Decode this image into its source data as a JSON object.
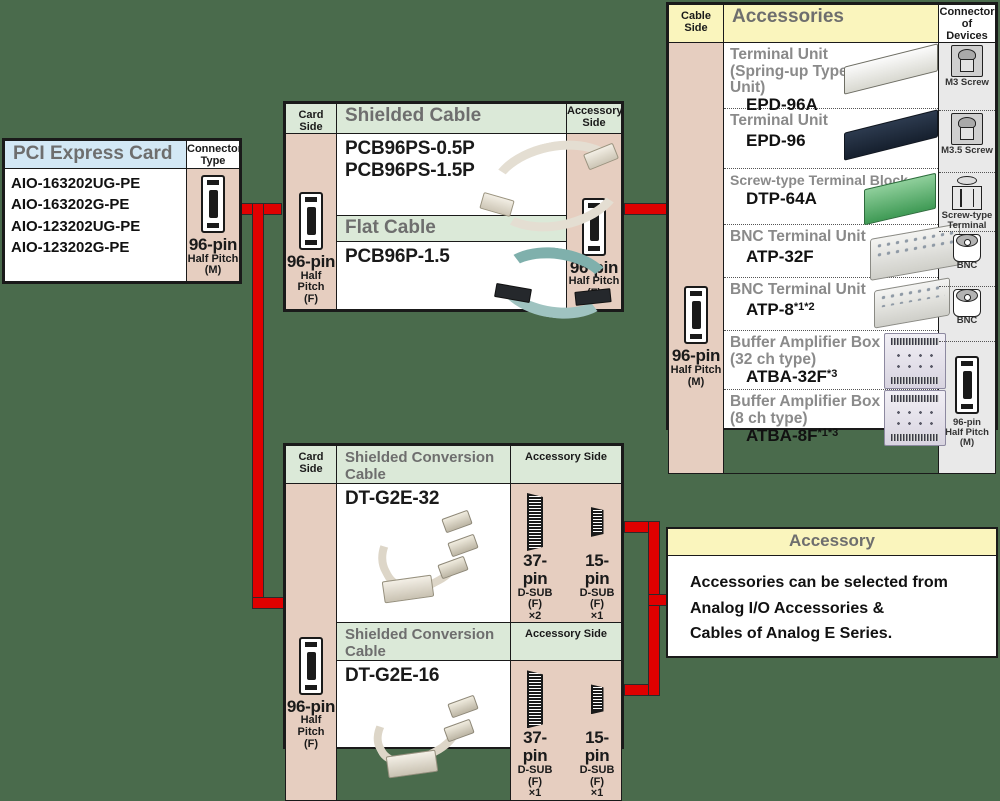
{
  "card_table": {
    "header": {
      "title": "PCI Express Card",
      "connector_col": "Connector\nType"
    },
    "models": [
      "AIO-163202UG-PE",
      "AIO-163202G-PE",
      "AIO-123202UG-PE",
      "AIO-123202G-PE"
    ],
    "connector": {
      "icon": "half-pitch-connector-icon",
      "pins": "96-pin",
      "type": "Half Pitch",
      "gender": "(M)"
    },
    "header_color": "#d3e8f5",
    "side_color": "#e6cec0"
  },
  "cable_table": {
    "card_side_label": "Card Side",
    "accessory_side_label": "Accessory Side",
    "card_side_connector": {
      "icon": "half-pitch-connector-icon",
      "pins": "96-pin",
      "type": "Half Pitch",
      "gender": "(F)"
    },
    "accessory_side_connector": {
      "icon": "half-pitch-connector-icon",
      "pins": "96-pin",
      "type": "Half Pitch",
      "gender": "(F)"
    },
    "sections": [
      {
        "title": "Shielded Cable",
        "parts": [
          "PCB96PS-0.5P",
          "PCB96PS-1.5P"
        ],
        "photo": "shielded-cable-photo"
      },
      {
        "title": "Flat Cable",
        "parts": [
          "PCB96P-1.5"
        ],
        "photo": "flat-cable-photo"
      }
    ],
    "header_color": "#dbe9d8"
  },
  "conversion_tables": [
    {
      "card_side_label": "Card Side",
      "title": "Shielded Conversion Cable",
      "accessory_side_label": "Accessory Side",
      "part": "DT-G2E-32",
      "photo": "conversion-cable-32-photo",
      "card_side_connector": {
        "icon": "half-pitch-connector-icon",
        "pins": "96-pin",
        "type": "Half Pitch",
        "gender": "(F)"
      },
      "accessory_connectors": [
        {
          "icon": "dsub-37-icon",
          "pins": "37-pin",
          "type": "D-SUB",
          "gender": "(F)",
          "qty": "×2"
        },
        {
          "icon": "dsub-15-icon",
          "pins": "15-pin",
          "type": "D-SUB",
          "gender": "(F)",
          "qty": "×1"
        }
      ]
    },
    {
      "card_side_label": "Card Side",
      "title": "Shielded Conversion Cable",
      "accessory_side_label": "Accessory Side",
      "part": "DT-G2E-16",
      "photo": "conversion-cable-16-photo",
      "card_side_connector": {
        "icon": "half-pitch-connector-icon",
        "pins": "96-pin",
        "type": "Half Pitch",
        "gender": "(F)"
      },
      "accessory_connectors": [
        {
          "icon": "dsub-37-icon",
          "pins": "37-pin",
          "type": "D-SUB",
          "gender": "(F)",
          "qty": "×1"
        },
        {
          "icon": "dsub-15-icon",
          "pins": "15-pin",
          "type": "D-SUB",
          "gender": "(F)",
          "qty": "×1"
        }
      ]
    }
  ],
  "accessories_table": {
    "cable_side_label": "Cable Side",
    "title": "Accessories",
    "devices_col_label": "Connector of\nDevices",
    "cable_side_connector": {
      "icon": "half-pitch-connector-icon",
      "pins": "96-pin",
      "type": "Half Pitch",
      "gender": "(M)"
    },
    "header_color": "#faf5bd",
    "rows": [
      {
        "name": "Terminal Unit",
        "subname": "(Spring-up Type Terminal Unit)",
        "code": "EPD-96A",
        "note": "",
        "photo": "terminal-unit-white-photo",
        "device_icon": "m3-screw-icon",
        "device_label": "M3 Screw"
      },
      {
        "name": "Terminal Unit",
        "subname": "",
        "code": "EPD-96",
        "note": "",
        "photo": "terminal-unit-dark-photo",
        "device_icon": "m35-screw-icon",
        "device_label": "M3.5 Screw"
      },
      {
        "name": "Screw-type Terminal Block",
        "subname": "",
        "code": "DTP-64A",
        "note": "",
        "photo": "terminal-block-green-photo",
        "device_icon": "screw-type-terminal-icon",
        "device_label": "Screw-type\nTerminal"
      },
      {
        "name": "BNC Terminal Unit",
        "subname": "",
        "code": "ATP-32F",
        "note": "",
        "photo": "bnc-terminal-32-photo",
        "device_icon": "bnc-icon",
        "device_label": "BNC"
      },
      {
        "name": "BNC Terminal Unit",
        "subname": "",
        "code": "ATP-8",
        "note": "*1*2",
        "photo": "bnc-terminal-8-photo",
        "device_icon": "bnc-icon",
        "device_label": "BNC"
      },
      {
        "name": "Buffer Amplifier Box",
        "subname": "(32 ch type)",
        "code": "ATBA-32F",
        "note": "*3",
        "photo": "buffer-amp-32-photo",
        "device_icon": "half-pitch-connector-icon",
        "device_label": ""
      },
      {
        "name": "Buffer Amplifier Box",
        "subname": "(8 ch type)",
        "code": "ATBA-8F",
        "note": "*1*3",
        "photo": "buffer-amp-8-photo",
        "device_icon": "half-pitch-connector-icon",
        "device_label": ""
      }
    ],
    "device_bottom_connector": {
      "pins": "96-pin",
      "type": "Half Pitch",
      "gender": "(M)"
    }
  },
  "accessory_note": {
    "title": "Accessory",
    "lines": [
      "Accessories can be selected from",
      "Analog I/O Accessories &",
      "Cables of Analog E Series."
    ],
    "header_color": "#faf5bd"
  },
  "theme": {
    "background": "#4a6b4c",
    "wire_color": "#e00000",
    "border_color": "#1a1a1a"
  }
}
